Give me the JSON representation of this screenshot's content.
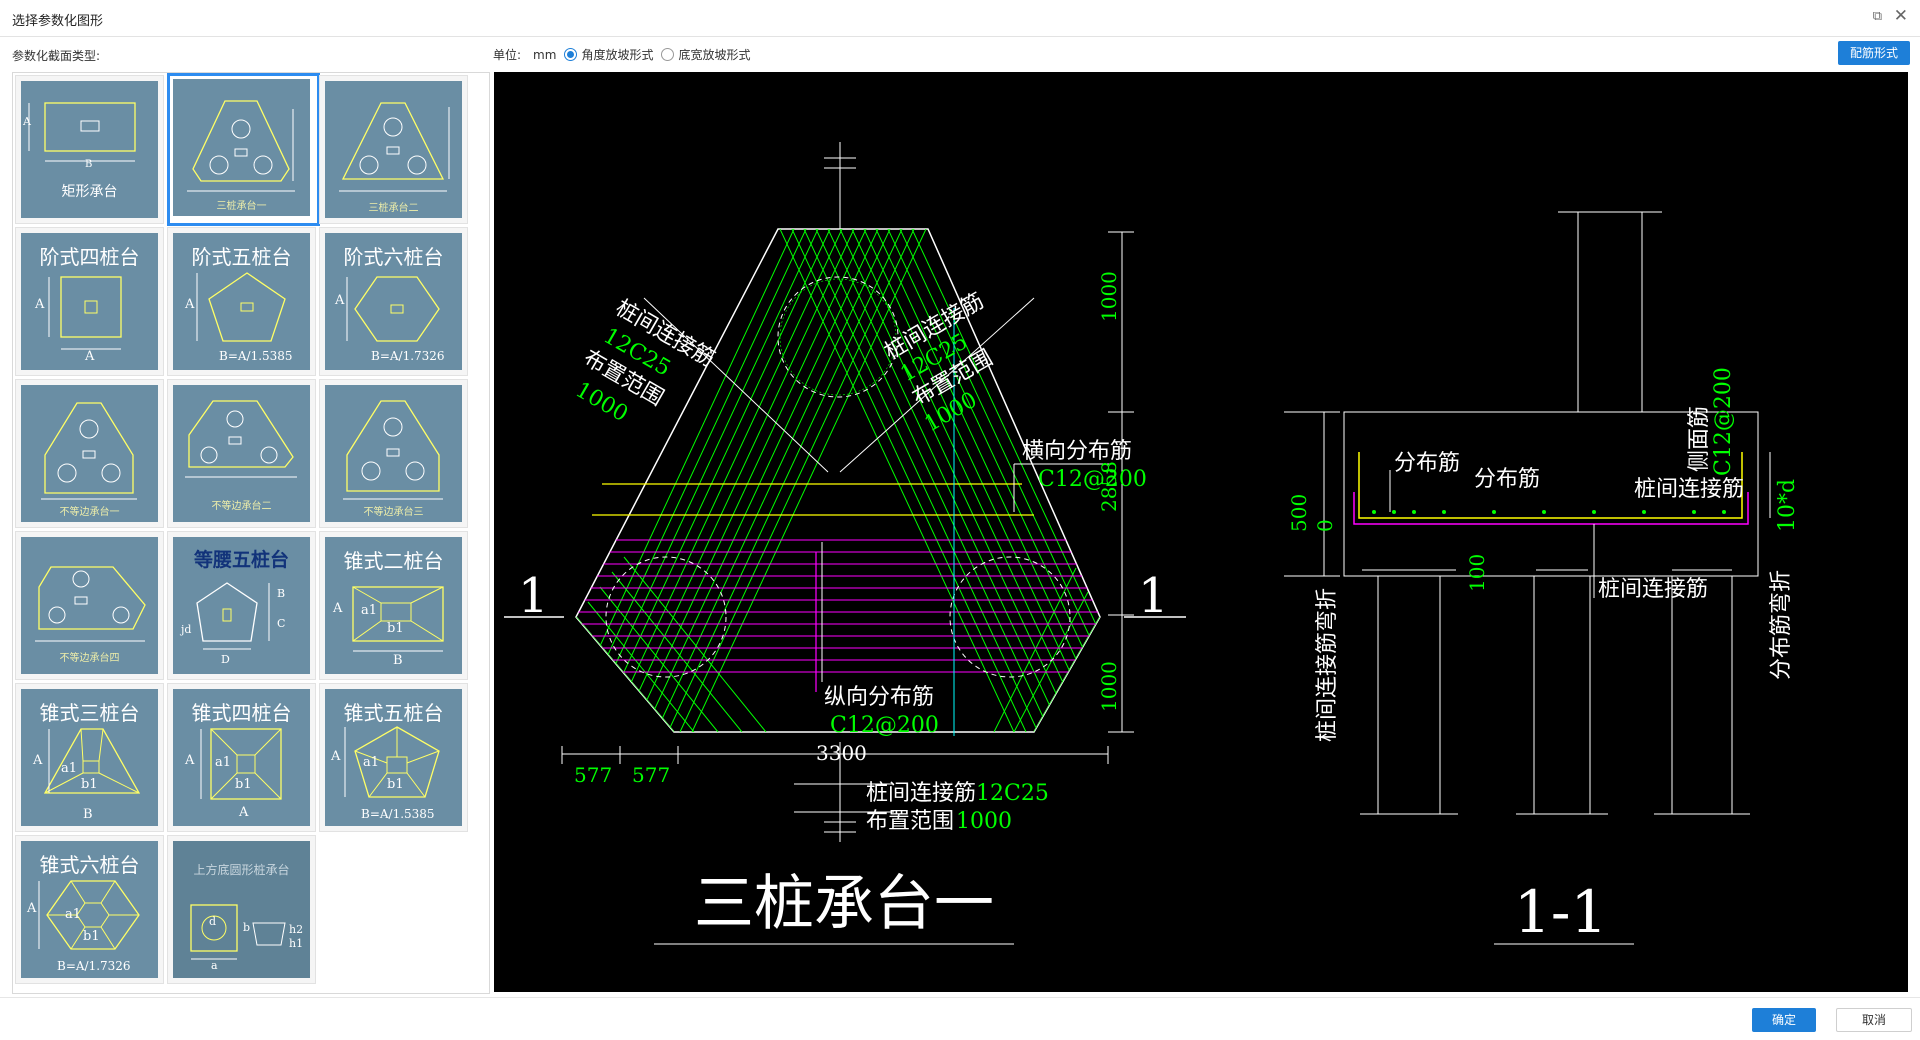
{
  "window": {
    "title": "选择参数化图形"
  },
  "toolbar": {
    "section_label": "参数化截面类型:",
    "unit_label": "单位:",
    "unit_value": "mm",
    "radio_options": [
      {
        "label": "角度放坡形式",
        "selected": true
      },
      {
        "label": "底宽放坡形式",
        "selected": false
      }
    ],
    "rebar_form_button": "配筋形式"
  },
  "gallery": {
    "items": [
      {
        "caption": "矩形承台",
        "labels": [
          "A",
          "B"
        ]
      },
      {
        "caption": "三桩承台一",
        "selected": true
      },
      {
        "caption": "三桩承台二"
      },
      {
        "caption": "阶式四桩台",
        "labels": [
          "A",
          "A"
        ]
      },
      {
        "caption": "阶式五桩台",
        "labels": [
          "A",
          "B=A/1.5385"
        ]
      },
      {
        "caption": "阶式六桩台",
        "labels": [
          "A",
          "B=A/1.7326"
        ]
      },
      {
        "caption": "不等边承台一"
      },
      {
        "caption": "不等边承台二"
      },
      {
        "caption": "不等边承台三"
      },
      {
        "caption": "不等边承台四"
      },
      {
        "caption": "等腰五桩台",
        "labels": [
          "B",
          "C",
          "jd",
          "D"
        ]
      },
      {
        "caption": "锥式二桩台",
        "labels": [
          "A",
          "a1",
          "b1",
          "B"
        ]
      },
      {
        "caption": "锥式三桩台",
        "labels": [
          "A",
          "a1",
          "b1",
          "B"
        ]
      },
      {
        "caption": "锥式四桩台",
        "labels": [
          "A",
          "a1",
          "b1",
          "A"
        ]
      },
      {
        "caption": "锥式五桩台",
        "labels": [
          "A",
          "a1",
          "b1",
          "B=A/1.5385"
        ]
      },
      {
        "caption": "锥式六桩台",
        "labels": [
          "A",
          "a1",
          "b1",
          "B=A/1.7326"
        ]
      },
      {
        "caption": "上方底圆形桩承台",
        "labels": [
          "d",
          "b",
          "h2",
          "h1",
          "a"
        ]
      }
    ]
  },
  "drawing": {
    "plan": {
      "title": "三桩承台一",
      "section_mark": "1",
      "labels": {
        "left_rebar": "桩间连接筋",
        "left_spec": "12C25",
        "left_range": "布置范围",
        "left_range_val": "1000",
        "right_rebar": "桩间连接筋",
        "right_spec": "12C25",
        "right_range": "布置范围",
        "right_range_val": "1000",
        "transverse": "横向分布筋",
        "transverse_spec": "C12@200",
        "longitudinal": "纵向分布筋",
        "longitudinal_spec": "C12@200",
        "bottom_rebar": "桩间连接筋",
        "bottom_spec": "12C25",
        "bottom_range": "布置范围",
        "bottom_range_val": "1000"
      },
      "dims": {
        "top": "1000",
        "middle": "2858",
        "bottom": "1000",
        "width": "3300",
        "left1": "577",
        "left2": "577"
      }
    },
    "section": {
      "title": "1-1",
      "labels": {
        "dist1": "分布筋",
        "dist2": "分布筋",
        "connect_top": "桩间连接筋",
        "connect_bottom": "桩间连接筋",
        "side": "侧面筋",
        "side_spec": "C12@200",
        "left_vertical": "桩间连接筋弯折",
        "right_vertical": "分布筋弯折",
        "right_spec": "10*d"
      },
      "dims": {
        "h500": "500",
        "h0": "0",
        "h100": "100"
      }
    }
  },
  "footer": {
    "ok": "确定",
    "cancel": "取消"
  },
  "colors": {
    "accent": "#1e7fd8",
    "thumb_bg": "#6a8ea4",
    "cad_bg": "#000000",
    "cad_green": "#00ff00",
    "cad_magenta": "#ff00ff",
    "cad_yellow": "#ffff00",
    "cad_cyan": "#00ffff"
  }
}
